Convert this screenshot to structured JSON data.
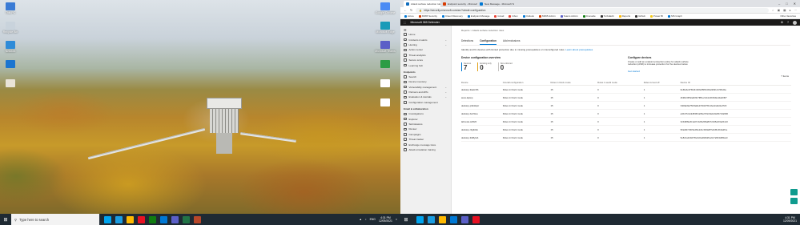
{
  "desktop": {
    "icons_left": [
      {
        "label": "This PC",
        "icon": "computer-icon",
        "color": "#3a7bd5"
      },
      {
        "label": "Recycle Bin",
        "icon": "recycle-bin-icon",
        "color": "#c9d3dc"
      },
      {
        "label": "Network",
        "icon": "network-icon",
        "color": "#2e8bd8"
      },
      {
        "label": "",
        "icon": "app-icon",
        "color": "#1b75d0"
      },
      {
        "label": "",
        "icon": "app-icon",
        "color": "#e9e4d8"
      }
    ],
    "icons_right": [
      {
        "label": "Google Chrome",
        "icon": "chrome-icon",
        "color": "#4b8bf4"
      },
      {
        "label": "Microsoft Edge",
        "icon": "edge-icon",
        "color": "#1a9bb8"
      },
      {
        "label": "Microsoft Teams",
        "icon": "teams-icon",
        "color": "#5b5fc7"
      },
      {
        "label": "",
        "icon": "file-icon",
        "color": "#2d9c45"
      },
      {
        "label": "",
        "icon": "file-icon",
        "color": "#ffffff"
      },
      {
        "label": "",
        "icon": "file-icon",
        "color": "#ffffff"
      }
    ]
  },
  "browser": {
    "tabs": [
      {
        "label": "Attack surface reduction rules",
        "color": "#0f6cbd",
        "active": true
      },
      {
        "label": "Endpoint security - Microsoft E",
        "color": "#d83b01",
        "active": false
      },
      {
        "label": "New Message - Microsoft Tech",
        "color": "#0078d4",
        "active": false
      }
    ],
    "window_controls": [
      "–",
      "□",
      "✕"
    ],
    "url": "https://security.microsoft.com/asr?viewid=configuration",
    "favorites": [
      {
        "label": "Azure",
        "color": "#0078d4"
      },
      {
        "label": "M365 Security",
        "color": "#d83b01"
      },
      {
        "label": "Cloud Discovery",
        "color": "#0078d4"
      },
      {
        "label": "Endpoint Manage",
        "color": "#0078d4"
      },
      {
        "label": "Gmail",
        "color": "#ea4335"
      },
      {
        "label": "Inbox",
        "color": "#ea4335"
      },
      {
        "label": "Outlook",
        "color": "#0078d4"
      },
      {
        "label": "M365 Admin",
        "color": "#d83b01"
      },
      {
        "label": "Teams Admin",
        "color": "#5b5fc7"
      },
      {
        "label": "Finevelle",
        "color": "#107c10"
      },
      {
        "label": "TurboEdit",
        "color": "#333333"
      },
      {
        "label": "Reports",
        "color": "#ffb900"
      },
      {
        "label": "Github",
        "color": "#333333"
      },
      {
        "label": "Power BI",
        "color": "#f2c811"
      },
      {
        "label": "MS Graph",
        "color": "#0078d4"
      }
    ],
    "other_favorites": "Other favorites"
  },
  "app": {
    "title": "Microsoft 365 Defender",
    "sidebar": [
      {
        "label": "Home",
        "icon": "home-icon",
        "chevron": false
      },
      {
        "label": "Incidents & alerts",
        "icon": "alert-icon",
        "chevron": true
      },
      {
        "label": "Hunting",
        "icon": "hunting-icon",
        "chevron": true
      },
      {
        "label": "Action center",
        "icon": "action-center-icon",
        "chevron": false
      },
      {
        "label": "Threat analytics",
        "icon": "threat-analytics-icon",
        "chevron": false
      },
      {
        "label": "Secure score",
        "icon": "secure-score-icon",
        "chevron": false
      },
      {
        "label": "Learning hub",
        "icon": "learning-hub-icon",
        "chevron": false
      }
    ],
    "section_endpoints": "Endpoints",
    "sidebar_endpoints": [
      {
        "label": "Search",
        "icon": "search-icon",
        "chevron": false
      },
      {
        "label": "Device inventory",
        "icon": "device-inventory-icon",
        "chevron": false
      },
      {
        "label": "Vulnerability management",
        "icon": "vulnerability-icon",
        "chevron": true
      },
      {
        "label": "Partners and APIs",
        "icon": "partners-icon",
        "chevron": true
      },
      {
        "label": "Evaluation & tutorials",
        "icon": "evaluation-icon",
        "chevron": true
      },
      {
        "label": "Configuration management",
        "icon": "configuration-icon",
        "chevron": false
      }
    ],
    "section_email": "Email & collaboration",
    "sidebar_email": [
      {
        "label": "Investigations",
        "icon": "investigations-icon",
        "chevron": false
      },
      {
        "label": "Explorer",
        "icon": "explorer-icon",
        "chevron": false
      },
      {
        "label": "Submissions",
        "icon": "submissions-icon",
        "chevron": false
      },
      {
        "label": "Review",
        "icon": "review-icon",
        "chevron": false
      },
      {
        "label": "Campaigns",
        "icon": "campaigns-icon",
        "chevron": false
      },
      {
        "label": "Threat tracker",
        "icon": "threat-tracker-icon",
        "chevron": false
      },
      {
        "label": "Exchange message trace",
        "icon": "message-trace-icon",
        "chevron": false
      },
      {
        "label": "Attack simulation training",
        "icon": "attack-simulation-icon",
        "chevron": false
      }
    ],
    "breadcrumb": "Reports  >  Attack surface reduction rules",
    "pivots": [
      "Detections",
      "Configuration",
      "Add exclusions"
    ],
    "active_pivot": "Configuration",
    "description": "Identify and fix devices with limited protection due to missing prerequisites or misconfigured rules.",
    "description_link": "Learn about prerequisites",
    "overview_title": "Device configuration overview",
    "metrics": [
      {
        "label": "Devices",
        "value": "7"
      },
      {
        "label": "Existing only",
        "value": "0"
      },
      {
        "label": "Not enforced",
        "value": "0"
      }
    ],
    "configure": {
      "title": "Configure devices",
      "text": "Create or add an endpoint protection policy for attack surface reduction (ASR) to increase protection for the devices below.",
      "link": "Get started"
    },
    "items_count": "7 items",
    "table_headers": [
      "Device",
      "Overall configuration",
      "Rules in block mode",
      "Rules in audit mode",
      "Rules turned off",
      "Device ID"
    ],
    "rows": [
      [
        "desktop-9sakr2fb",
        "Rules in block mode",
        "15",
        "0",
        "1",
        "6ef0e6e97f0d41b0fe95f6b4b3e9b91c1f3f1d4e"
      ],
      [
        "asus-laptop",
        "Rules in block mode",
        "15",
        "0",
        "1",
        "4b9f2c0f52a2b6b7f8f1e7ab1c0b5d9e44a20f67"
      ],
      [
        "desktop-p3k4dqcr",
        "Rules in block mode",
        "15",
        "0",
        "1",
        "f118ab9a7f9c5a8e27fd3d7f6c1be0ca9d1a7f20"
      ],
      [
        "desktop-bwr9iua",
        "Rules in block mode",
        "15",
        "0",
        "1",
        "a4b1f7c2e9d83f01a56e7bf2c9a1d0e8b7c6a590"
      ],
      [
        "labnode-w4520",
        "Rules in block mode",
        "15",
        "0",
        "1",
        "3c6d9f8e2b1a07c4d5e6f9a8b7c6d5e4f3a2b1c0"
      ],
      [
        "desktop-r3g9ddu",
        "Rules in block mode",
        "15",
        "0",
        "1",
        "9f4e8d7c6b5a4f3e2d1c0b9a8f7e6d5c4b3a2f1e"
      ],
      [
        "desktop-9di8ytab",
        "Rules in block mode",
        "15",
        "0",
        "1",
        "5e8c2a1b9d7f6e3c0a4b8d2f1e9c7a5b3d6f0e2c"
      ]
    ]
  },
  "taskbar_left": {
    "search_placeholder": "Type here to search",
    "apps": [
      "#00a4ef",
      "#1b9de2",
      "#ffb900",
      "#e81123",
      "#107c10",
      "#0078d4",
      "#5b5fc7",
      "#217346",
      "#b7472a"
    ],
    "lang": "ENG",
    "time": "4:31 PM",
    "date": "12/09/2021"
  },
  "taskbar_right": {
    "apps": [
      "#00a4ef",
      "#1b9de2",
      "#ffb900",
      "#0078d4",
      "#5b5fc7",
      "#e81123"
    ],
    "time": "4:31 PM",
    "date": "12/09/2021"
  }
}
